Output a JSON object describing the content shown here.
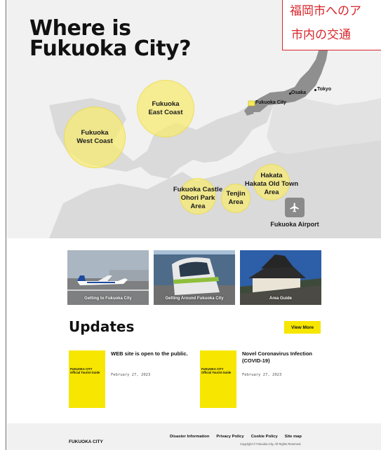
{
  "hero": {
    "title": "Where is\nFukuoka City?",
    "jp_banner": {
      "line1": "福岡市へのア",
      "line2": "市内の交通"
    },
    "map": {
      "japan_labels": {
        "osaka": "Osaka",
        "tokyo": "Tokyo",
        "fukuoka_city": "Fukuoka City"
      },
      "areas": [
        {
          "id": "west-coast",
          "label": "Fukuoka\nWest Coast"
        },
        {
          "id": "east-coast",
          "label": "Fukuoka\nEast Coast"
        },
        {
          "id": "castle",
          "label": "Fukuoka Castle\nOhori Park\nArea"
        },
        {
          "id": "tenjin",
          "label": "Tenjin\nArea"
        },
        {
          "id": "hakata",
          "label": "Hakata\nHakata Old Town\nArea"
        }
      ],
      "airport_label": "Fukuoka Airport",
      "airport_icon": "airplane-icon"
    }
  },
  "cards": [
    {
      "label": "Getting to Fukuoka City"
    },
    {
      "label": "Getting Around Fukuoka City"
    },
    {
      "label": "Area Guide"
    }
  ],
  "updates": {
    "title": "Updates",
    "view_more": "View More",
    "items": [
      {
        "title": "WEB site is open to the public.",
        "date": "February 27, 2023",
        "thumb_text": "FUKUOKA CITY\nOfficial Tourist Guide"
      },
      {
        "title": "Novel Coronavirus Infection (COVID-19)",
        "date": "February 27, 2023",
        "thumb_text": "FUKUOKA CITY\nOfficial Tourist Guide"
      }
    ]
  },
  "footer": {
    "brand": "FUKUOKA CITY",
    "links": [
      "Disaster Information",
      "Privacy Policy",
      "Cookie Policy",
      "Site map"
    ],
    "copyright": "Copyright © Fukuoka City. All Rights Reserved."
  },
  "colors": {
    "accent_yellow": "#f6e600",
    "bubble_yellow": "#f8eb6e",
    "jp_red": "#d8262c",
    "map_gray": "#d9d9d9",
    "japan_gray": "#8f8f8f"
  }
}
